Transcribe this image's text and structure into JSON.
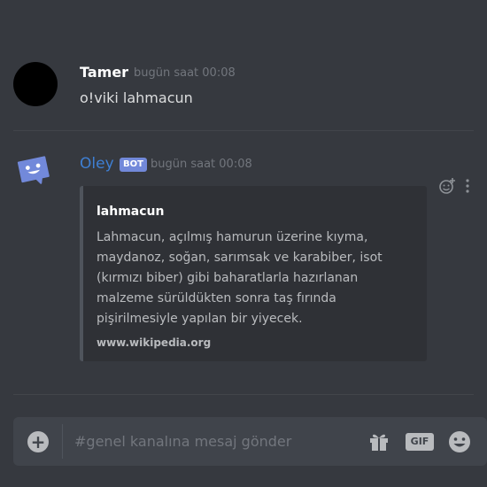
{
  "messages": [
    {
      "author": "Tamer",
      "timestamp": "bugün saat 00:08",
      "content": "o!viki lahmacun"
    },
    {
      "author": "Oley",
      "bot_tag": "BOT",
      "timestamp": "bugün saat 00:08",
      "embed": {
        "title": "lahmacun",
        "description": "Lahmacun, açılmış hamurun üzerine kıyma, maydanoz, soğan, sarımsak ve karabiber, isot (kırmızı biber) gibi baharatlarla hazırlanan malzeme sürüldükten sonra taş fırında pişirilmesiyle yapılan bir yiyecek.",
        "footer": "www.wikipedia.org"
      }
    }
  ],
  "composer": {
    "placeholder": "#genel kanalına mesaj gönder",
    "gif_label": "GIF"
  },
  "icons": {
    "add_reaction": "add-reaction-icon",
    "more": "more-options-icon",
    "plus": "plus-icon",
    "gift": "gift-icon",
    "emoji": "emoji-icon"
  },
  "colors": {
    "background": "#36393f",
    "bot_name": "#3e7fd3",
    "bot_tag": "#7289da",
    "embed_bg": "#2f3136",
    "composer_bg": "#40444b"
  }
}
